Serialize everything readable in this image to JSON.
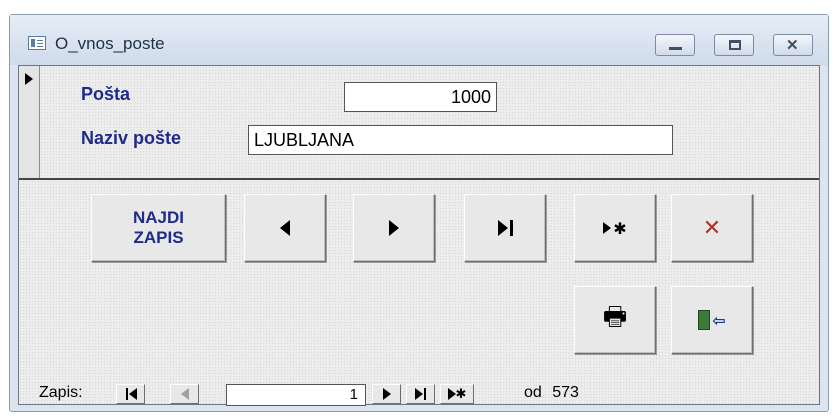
{
  "window": {
    "title": "O_vnos_poste",
    "controls": [
      "minimize",
      "maximize",
      "close"
    ],
    "close_glyph": "✕"
  },
  "form": {
    "fields": [
      {
        "label": "Pošta",
        "value": "1000"
      },
      {
        "label": "Naziv pošte",
        "value": "LJUBLJANA"
      }
    ]
  },
  "buttons": {
    "najdi_line1": "NAJDI",
    "najdi_line2": "ZAPIS",
    "icons": [
      "previous-record-icon",
      "next-record-icon",
      "last-record-icon",
      "new-record-icon",
      "delete-record-icon",
      "print-icon",
      "exit-icon"
    ],
    "print_glyph": "🖶",
    "new_glyph": "✱",
    "delete_glyph": "✕",
    "exit_glyph": "⇦"
  },
  "navigation": {
    "label": "Zapis:",
    "current": "1",
    "of_label": "od",
    "total": "573"
  },
  "colors": {
    "label": "#1e2a8c",
    "delete": "#b03030",
    "exit": "#1e6b2e"
  }
}
